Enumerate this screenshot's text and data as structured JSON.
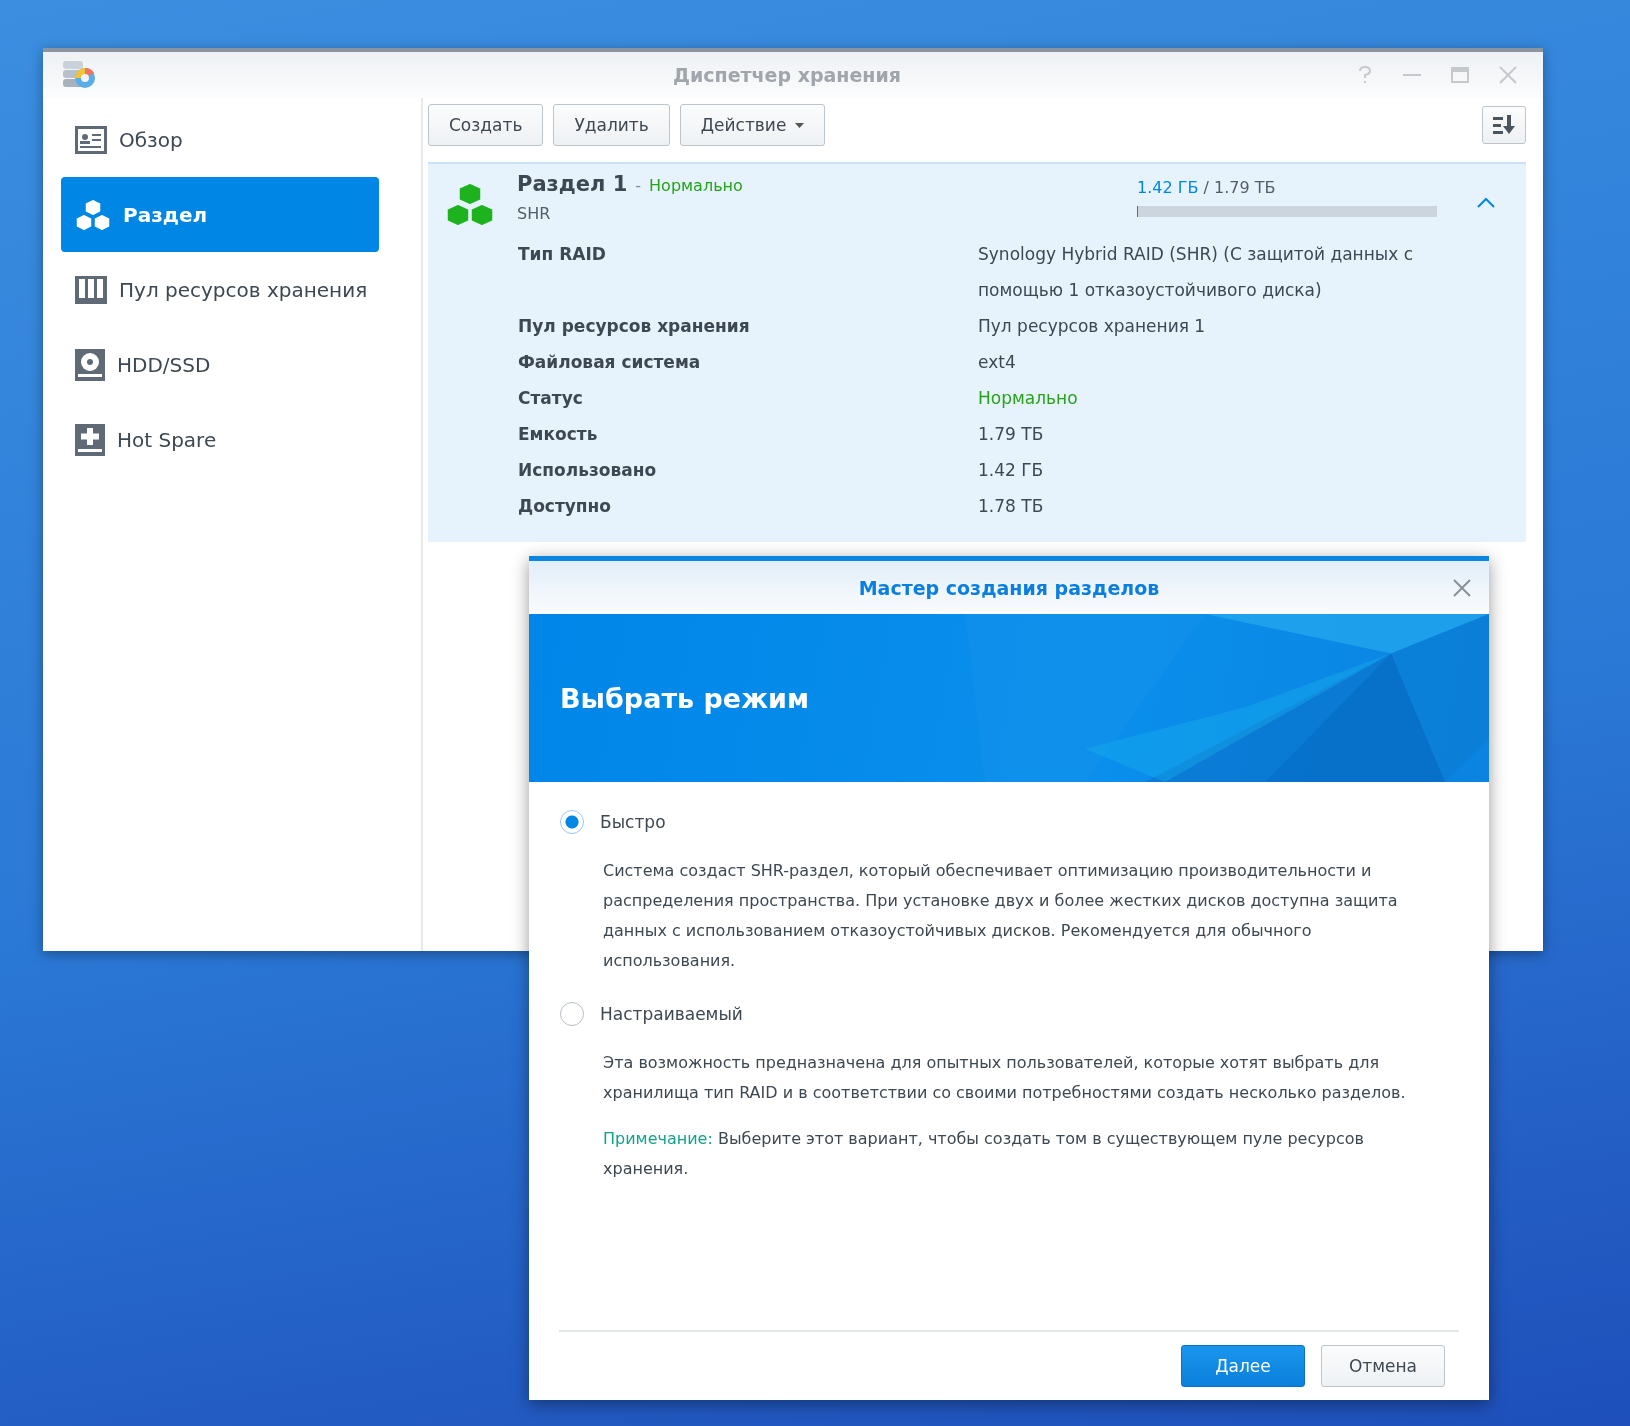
{
  "window": {
    "title": "Диспетчер хранения"
  },
  "sidebar": {
    "items": [
      {
        "label": "Обзор",
        "kind": "overview",
        "selected": false
      },
      {
        "label": "Раздел",
        "kind": "volume",
        "selected": true
      },
      {
        "label": "Пул ресурсов хранения",
        "kind": "pool",
        "selected": false
      },
      {
        "label": "HDD/SSD",
        "kind": "disk",
        "selected": false
      },
      {
        "label": "Hot Spare",
        "kind": "spare",
        "selected": false
      }
    ]
  },
  "toolbar": {
    "buttons": [
      {
        "label": "Создать",
        "dropdown": false
      },
      {
        "label": "Удалить",
        "dropdown": false
      },
      {
        "label": "Действие",
        "dropdown": true
      }
    ]
  },
  "volume": {
    "name": "Раздел 1",
    "status_separator": "-",
    "status": "Нормально",
    "type": "SHR",
    "used": "1.42 ГБ",
    "total": "/ 1.79 ТБ",
    "level": 0.001,
    "expanded": true,
    "details": [
      {
        "label": "Тип RAID",
        "value": "Synology Hybrid RAID (SHR) (С защитой данных с помощью 1 отказоустойчивого диска)",
        "kind": "text"
      },
      {
        "label": "Пул ресурсов хранения",
        "value": "Пул ресурсов хранения 1",
        "kind": "text"
      },
      {
        "label": "Файловая система",
        "value": "ext4",
        "kind": "text"
      },
      {
        "label": "Статус",
        "value": "Нормально",
        "kind": "status"
      },
      {
        "label": "Емкость",
        "value": "1.79 ТБ",
        "kind": "text"
      },
      {
        "label": "Использовано",
        "value": "1.42 ГБ",
        "kind": "text"
      },
      {
        "label": "Доступно",
        "value": "1.78 ТБ",
        "kind": "text"
      }
    ]
  },
  "dialog": {
    "title": "Мастер создания разделов",
    "heading": "Выбрать режим",
    "options": [
      {
        "label": "Быстро",
        "selected": true,
        "paragraphs": [
          "Система создаст SHR-раздел, который обеспечивает оптимизацию производительности и распределения пространства. При установке двух и более жестких дисков доступна защита данных с использованием отказоустойчивых дисков. Рекомендуется для обычного использования."
        ]
      },
      {
        "label": "Настраиваемый",
        "selected": false,
        "paragraphs": [
          "Эта возможность предназначена для опытных пользователей, которые хотят выбрать для хранилища тип RAID и в соответствии со своими потребностями создать несколько разделов."
        ],
        "note": {
          "label": "Примечание:",
          "text": "Выберите этот вариант, чтобы создать том в существующем пуле ресурсов хранения."
        }
      }
    ],
    "buttons": [
      {
        "label": "Далее",
        "primary": true
      },
      {
        "label": "Отмена",
        "primary": false
      }
    ]
  }
}
